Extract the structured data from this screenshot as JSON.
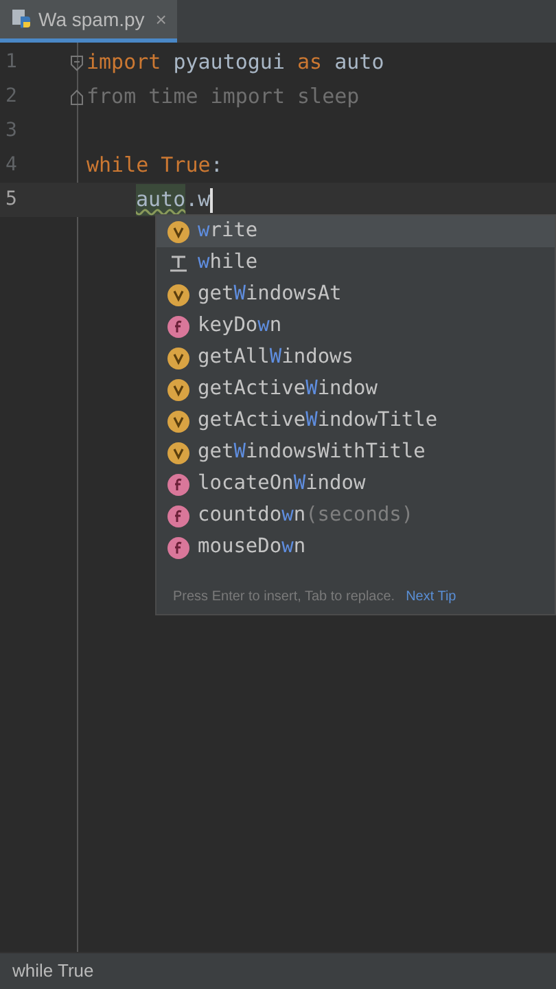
{
  "tab": {
    "title": "Wa spam.py",
    "close": "×",
    "selected": true
  },
  "editor": {
    "lines": [
      {
        "number": "1",
        "current": false,
        "fold_start": true,
        "tokens": [
          {
            "kind": "keyword",
            "text": "import "
          },
          {
            "kind": "plain",
            "text": "pyautogui "
          },
          {
            "kind": "keyword",
            "text": "as "
          },
          {
            "kind": "plain",
            "text": "auto"
          }
        ]
      },
      {
        "number": "2",
        "current": false,
        "fold_end": true,
        "tokens": [
          {
            "kind": "unused",
            "text": "from time import sleep"
          }
        ]
      },
      {
        "number": "3",
        "current": false
      },
      {
        "number": "4",
        "current": false,
        "tokens": [
          {
            "kind": "keyword",
            "text": "while True"
          },
          {
            "kind": "plain",
            "text": ":"
          }
        ]
      },
      {
        "number": "5",
        "current": true,
        "indented": true,
        "tokens": [
          {
            "kind": "marked",
            "text": "auto"
          },
          {
            "kind": "plain",
            "text": ".w"
          }
        ]
      }
    ]
  },
  "completion": {
    "items": [
      {
        "kind": "variable",
        "selected": true,
        "match": "w",
        "post": "rite"
      },
      {
        "kind": "template",
        "selected": false,
        "match": "w",
        "post": "hile"
      },
      {
        "kind": "variable",
        "selected": false,
        "pre": "get",
        "match": "W",
        "post": "indowsAt"
      },
      {
        "kind": "function",
        "selected": false,
        "pre": "keyDo",
        "match": "w",
        "post": "n"
      },
      {
        "kind": "variable",
        "selected": false,
        "pre": "getAll",
        "match": "W",
        "post": "indows"
      },
      {
        "kind": "variable",
        "selected": false,
        "pre": "getActive",
        "match": "W",
        "post": "indow"
      },
      {
        "kind": "variable",
        "selected": false,
        "pre": "getActive",
        "match": "W",
        "post": "indowTitle"
      },
      {
        "kind": "variable",
        "selected": false,
        "pre": "get",
        "match": "W",
        "post": "indowsWithTitle"
      },
      {
        "kind": "function",
        "selected": false,
        "pre": "locateOn",
        "match": "W",
        "post": "indow"
      },
      {
        "kind": "function",
        "selected": false,
        "pre": "countdo",
        "match": "w",
        "post": "n",
        "hint": "(seconds)"
      },
      {
        "kind": "function",
        "selected": false,
        "pre": "mouseDo",
        "match": "w",
        "post": "n"
      }
    ],
    "tip": "Press Enter to insert, Tab to replace.",
    "tip_link": "Next Tip"
  },
  "status_bar": {
    "text": "while True"
  }
}
